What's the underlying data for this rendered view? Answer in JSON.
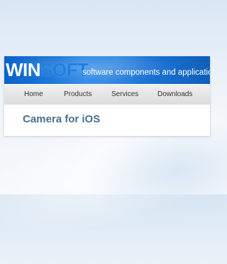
{
  "header": {
    "logo_part1": "WIN",
    "logo_part2": "SOFT",
    "tagline": "software components and applications"
  },
  "nav": {
    "items": [
      {
        "label": "Home"
      },
      {
        "label": "Products"
      },
      {
        "label": "Services"
      },
      {
        "label": "Downloads"
      }
    ]
  },
  "main": {
    "title": "Camera for iOS"
  },
  "colors": {
    "banner_blue": "#1b73d6",
    "logo_soft_blue": "#1e7fe1",
    "title_blue": "#4a6f93",
    "nav_gray": "#dcdcdc"
  }
}
